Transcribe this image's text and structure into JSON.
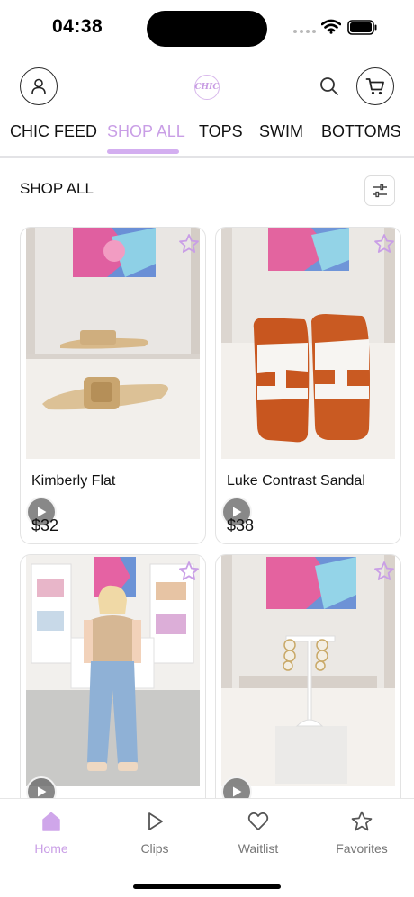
{
  "status_bar": {
    "time": "04:38"
  },
  "header": {
    "logo_text": "CHIC",
    "icons": [
      "account-icon",
      "chic-logo",
      "search-icon",
      "cart-icon"
    ]
  },
  "category_tabs": [
    {
      "label": "CHIC FEED",
      "active": false
    },
    {
      "label": "SHOP ALL",
      "active": true
    },
    {
      "label": "TOPS",
      "active": false
    },
    {
      "label": "SWIM",
      "active": false
    },
    {
      "label": "BOTTOMS",
      "active": false
    }
  ],
  "section": {
    "title": "SHOP ALL",
    "filter_icon": "sliders-icon"
  },
  "products": [
    {
      "name": "Kimberly Flat",
      "price": "$32",
      "image": "gold-buckle-flat-sandals"
    },
    {
      "name": "Luke Contrast Sandal",
      "price": "$38",
      "image": "orange-white-h-sandals"
    },
    {
      "name": "",
      "price": "",
      "image": "model-in-tan-top-and-jeans"
    },
    {
      "name": "",
      "price": "",
      "image": "pearl-hoop-earrings-on-stand"
    }
  ],
  "bottom_nav": [
    {
      "label": "Home",
      "icon": "home-icon",
      "active": true
    },
    {
      "label": "Clips",
      "icon": "play-icon",
      "active": false
    },
    {
      "label": "Waitlist",
      "icon": "heart-icon",
      "active": false
    },
    {
      "label": "Favorites",
      "icon": "star-icon",
      "active": false
    }
  ],
  "colors": {
    "accent": "#c99ee6",
    "tab_underline": "#d3aef0",
    "text": "#111111",
    "border": "#e3e3e3"
  }
}
